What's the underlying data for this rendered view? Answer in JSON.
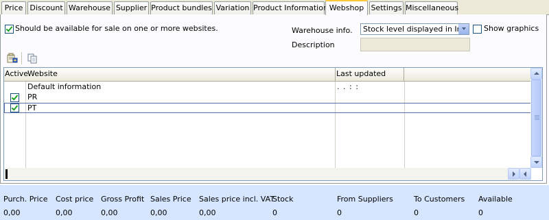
{
  "tabs": [
    {
      "label": "Price"
    },
    {
      "label": "Discount"
    },
    {
      "label": "Warehouse"
    },
    {
      "label": "Supplier"
    },
    {
      "label": "Product bundles"
    },
    {
      "label": "Variation"
    },
    {
      "label": "Product Information"
    },
    {
      "label": "Webshop"
    },
    {
      "label": "Settings"
    },
    {
      "label": "Miscellaneous"
    }
  ],
  "webshop": {
    "available_for_sale_label": "Should be available for sale on one or more websites.",
    "available_for_sale_checked": true,
    "warehouse_info_label": "Warehouse info.",
    "warehouse_info_value": "Stock level displayed in Inter",
    "show_graphics_label": "Show graphics",
    "show_graphics_checked": false,
    "description_label": "Description",
    "description_value": ""
  },
  "toolbar": {
    "icons": [
      "edit-website-icon",
      "copy-icon"
    ]
  },
  "grid": {
    "columns": [
      "Active",
      "Website",
      "Last updated"
    ],
    "rows": [
      {
        "active": null,
        "website": "Default information",
        "last_updated": ". .      : :"
      },
      {
        "active": true,
        "website": "PR",
        "last_updated": ""
      },
      {
        "active": true,
        "website": "PT",
        "last_updated": "",
        "selected": true
      }
    ]
  },
  "footer": {
    "columns": [
      {
        "title": "Purch. Price",
        "value": "0,00"
      },
      {
        "title": "Cost price",
        "value": "0,00"
      },
      {
        "title": "Gross Profit",
        "value": "0,00"
      },
      {
        "title": "Sales Price",
        "value": "0,00"
      },
      {
        "title": "Sales price incl. VAT",
        "value": "0,00"
      },
      {
        "title": "Stock",
        "value": "0"
      },
      {
        "title": "From Suppliers",
        "value": "0"
      },
      {
        "title": "To Customers",
        "value": "0"
      },
      {
        "title": "Available",
        "value": "0"
      }
    ]
  },
  "colors": {
    "active_tab_accent": "#ffc83c",
    "footer_bg": "#d7e6ff",
    "check_green": "#21a121"
  }
}
